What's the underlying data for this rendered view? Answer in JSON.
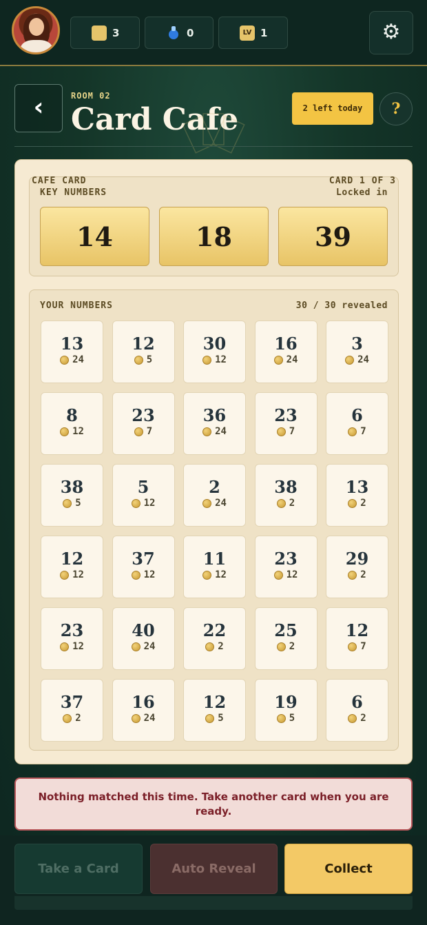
{
  "topbar": {
    "coins": "3",
    "potions": "0",
    "level_icon": "LV",
    "level": "1"
  },
  "header": {
    "room_label": "ROOM 02",
    "title": "Card Cafe",
    "left_today": "2 left today",
    "help": "?"
  },
  "key_card": {
    "label_line1": "CAFE CARD",
    "label_line2": "KEY NUMBERS",
    "card_status_line1": "CARD 1 OF 3",
    "card_status_line2": "Locked in",
    "numbers": [
      "14",
      "18",
      "39"
    ]
  },
  "your_numbers": {
    "label": "YOUR NUMBERS",
    "revealed": "30 / 30 revealed",
    "cells": [
      {
        "num": "13",
        "pay": "24"
      },
      {
        "num": "12",
        "pay": "5"
      },
      {
        "num": "30",
        "pay": "12"
      },
      {
        "num": "16",
        "pay": "24"
      },
      {
        "num": "3",
        "pay": "24"
      },
      {
        "num": "8",
        "pay": "12"
      },
      {
        "num": "23",
        "pay": "7"
      },
      {
        "num": "36",
        "pay": "24"
      },
      {
        "num": "23",
        "pay": "7"
      },
      {
        "num": "6",
        "pay": "7"
      },
      {
        "num": "38",
        "pay": "5"
      },
      {
        "num": "5",
        "pay": "12"
      },
      {
        "num": "2",
        "pay": "24"
      },
      {
        "num": "38",
        "pay": "2"
      },
      {
        "num": "13",
        "pay": "2"
      },
      {
        "num": "12",
        "pay": "12"
      },
      {
        "num": "37",
        "pay": "12"
      },
      {
        "num": "11",
        "pay": "12"
      },
      {
        "num": "23",
        "pay": "12"
      },
      {
        "num": "29",
        "pay": "2"
      },
      {
        "num": "23",
        "pay": "12"
      },
      {
        "num": "40",
        "pay": "24"
      },
      {
        "num": "22",
        "pay": "2"
      },
      {
        "num": "25",
        "pay": "2"
      },
      {
        "num": "12",
        "pay": "7"
      },
      {
        "num": "37",
        "pay": "2"
      },
      {
        "num": "16",
        "pay": "24"
      },
      {
        "num": "12",
        "pay": "5"
      },
      {
        "num": "19",
        "pay": "5"
      },
      {
        "num": "6",
        "pay": "2"
      }
    ]
  },
  "message": "Nothing matched this time. Take another card when you are ready.",
  "actions": {
    "take": "Take a Card",
    "auto": "Auto Reveal",
    "collect": "Collect"
  }
}
